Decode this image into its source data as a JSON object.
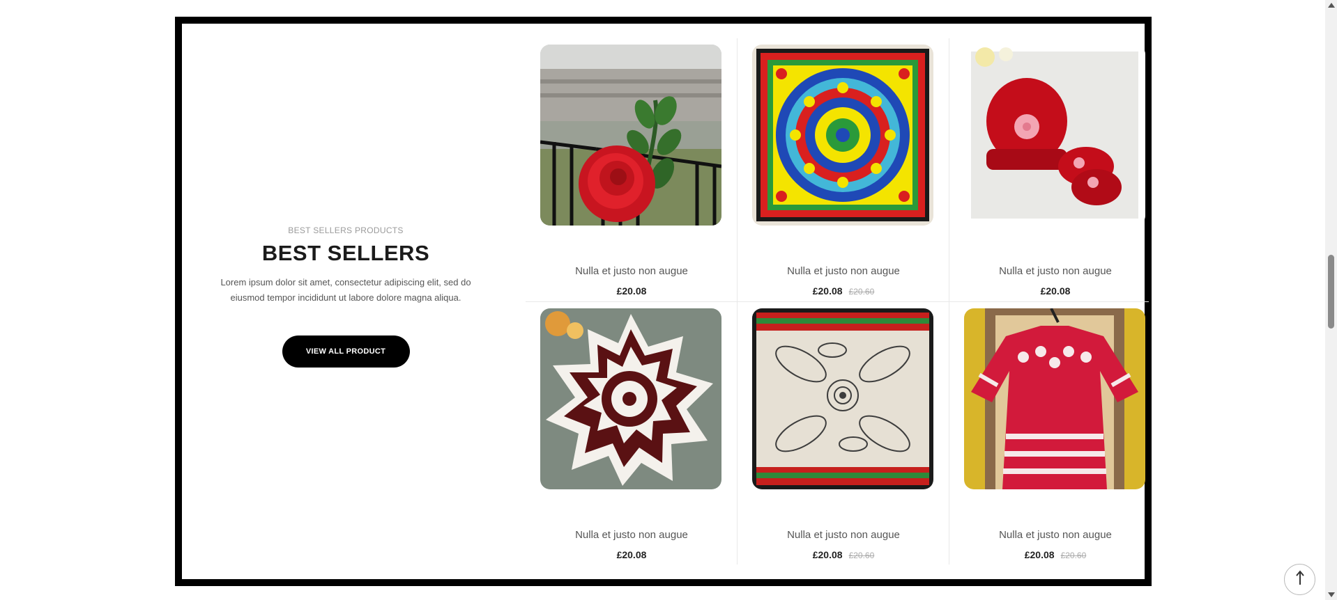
{
  "section": {
    "subtitle": "BEST SELLERS PRODUCTS",
    "title": "BEST SELLERS",
    "description": "Lorem ipsum dolor sit amet, consectetur adipiscing elit, sed do eiusmod tempor incididunt ut labore dolore magna aliqua.",
    "button_label": "VIEW ALL PRODUCT"
  },
  "products": [
    {
      "name": "Nulla et justo non augue",
      "price": "£20.08",
      "old_price": ""
    },
    {
      "name": "Nulla et justo non augue",
      "price": "£20.08",
      "old_price": "£20.60"
    },
    {
      "name": "Nulla et justo non augue",
      "price": "£20.08",
      "old_price": ""
    },
    {
      "name": "Nulla et justo non augue",
      "price": "£20.08",
      "old_price": ""
    },
    {
      "name": "Nulla et justo non augue",
      "price": "£20.08",
      "old_price": "£20.60"
    },
    {
      "name": "Nulla et justo non augue",
      "price": "£20.08",
      "old_price": "£20.60"
    }
  ],
  "icons": {
    "back_to_top": "arrow-up-icon"
  }
}
